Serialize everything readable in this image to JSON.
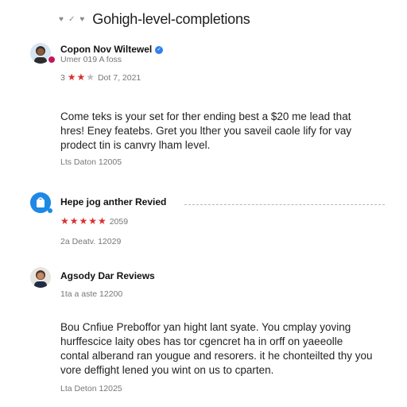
{
  "header": {
    "title": "Gohigh-level-completions",
    "icons": [
      "heart-icon",
      "chevron-icon",
      "heart-icon"
    ]
  },
  "reviews": [
    {
      "name": "Copon Nov Wiltewel",
      "sub": "Umer 019 A foss",
      "rating_prefix": "3",
      "rating_date": "Dot 7, 2021",
      "stars": 3,
      "body": [
        "Come teks is your set for ther ending best a $20 me lead that",
        "hres! Eney featebs. Gret you lther you saveil caole lify for vay",
        "prodect tin is canvry lham level."
      ],
      "footer": "Lts Daton 12005",
      "avatar": "person-avatar"
    },
    {
      "name": "Hepe jog anther Revied",
      "rating_suffix": "2059",
      "stars": 5,
      "sub": "2a Deatv. 12029",
      "avatar": "bag-avatar"
    },
    {
      "name": "Agsody Dar Reviews",
      "sub": "1ta a aste 12200",
      "body": [
        "Bou Cnfiue Preboffor yan hight lant syate. You cmplay yoving",
        "hurffescice laity obes has tor cgencret ha in orff on yaeeolle",
        "contal alberand ran yougue and resorers. it he chonteilted thy you",
        "vore deffight lened you wint on us to cparten."
      ],
      "footer": "Lta Deton 12025",
      "avatar": "person-avatar"
    }
  ],
  "colors": {
    "star": "#d9302f",
    "accent": "#1e88e5",
    "verified": "#2f80ed"
  }
}
